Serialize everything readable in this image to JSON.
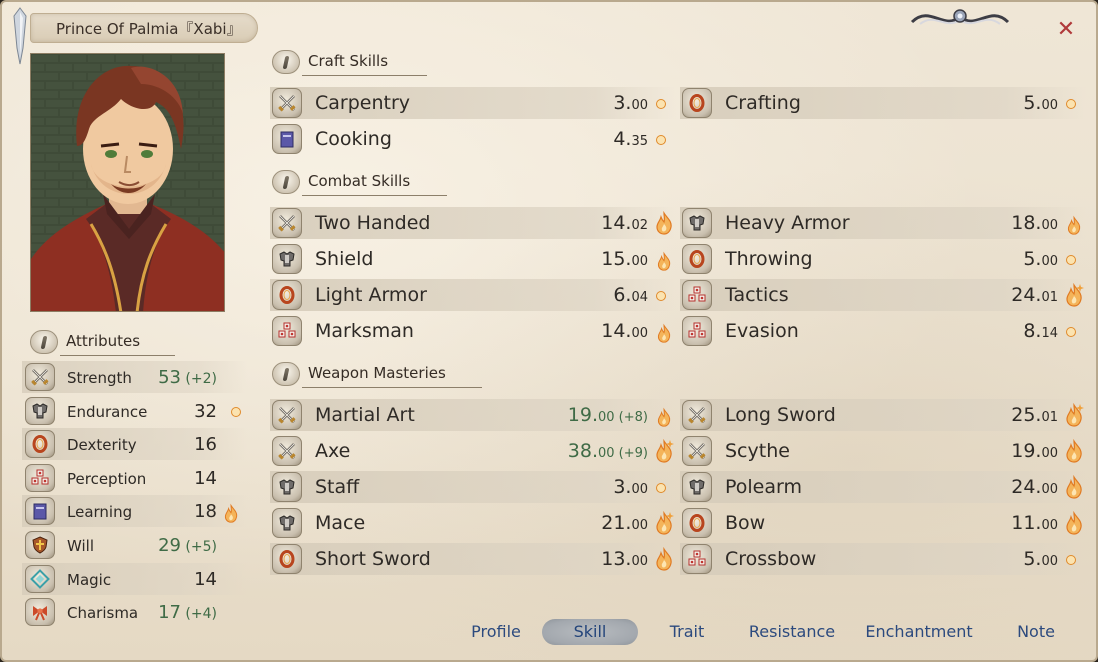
{
  "window": {
    "title": "Prince Of Palmia『Xabi』",
    "close_glyph": "✕"
  },
  "sections": {
    "craft": "Craft Skills",
    "combat": "Combat Skills",
    "weapon": "Weapon Masteries",
    "attributes": "Attributes"
  },
  "craft_skills": [
    {
      "name": "Carpentry",
      "int": "3.",
      "dec": "00",
      "icon": "crossed-swords-icon",
      "potential": "small"
    },
    {
      "name": "Crafting",
      "int": "5.",
      "dec": "00",
      "icon": "red-ring-icon",
      "potential": "small"
    },
    {
      "name": "Cooking",
      "int": "4.",
      "dec": "35",
      "icon": "book-icon",
      "potential": "small"
    }
  ],
  "combat_skills": [
    {
      "name": "Two Handed",
      "int": "14.",
      "dec": "02",
      "icon": "crossed-swords-icon",
      "potential": "flame"
    },
    {
      "name": "Heavy Armor",
      "int": "18.",
      "dec": "00",
      "icon": "armor-icon",
      "potential": "flame-small"
    },
    {
      "name": "Shield",
      "int": "15.",
      "dec": "00",
      "icon": "armor-icon",
      "potential": "flame-small"
    },
    {
      "name": "Throwing",
      "int": "5.",
      "dec": "00",
      "icon": "red-ring-icon",
      "potential": "small"
    },
    {
      "name": "Light Armor",
      "int": "6.",
      "dec": "04",
      "icon": "red-ring-icon",
      "potential": "small"
    },
    {
      "name": "Tactics",
      "int": "24.",
      "dec": "01",
      "icon": "dice-icon",
      "potential": "flame-sparkle"
    },
    {
      "name": "Marksman",
      "int": "14.",
      "dec": "00",
      "icon": "dice-icon",
      "potential": "flame-small"
    },
    {
      "name": "Evasion",
      "int": "8.",
      "dec": "14",
      "icon": "dice-icon",
      "potential": "small"
    }
  ],
  "weapon_masteries": [
    {
      "name": "Martial Art",
      "int": "19.",
      "dec": "00",
      "bonus": " (+8)",
      "icon": "crossed-swords-icon",
      "potential": "flame-small"
    },
    {
      "name": "Long Sword",
      "int": "25.",
      "dec": "01",
      "bonus": "",
      "icon": "crossed-swords-icon",
      "potential": "flame-sparkle"
    },
    {
      "name": "Axe",
      "int": "38.",
      "dec": "00",
      "bonus": " (+9)",
      "icon": "crossed-swords-icon",
      "potential": "flame-sparkle"
    },
    {
      "name": "Scythe",
      "int": "19.",
      "dec": "00",
      "bonus": "",
      "icon": "crossed-swords-icon",
      "potential": "flame"
    },
    {
      "name": "Staff",
      "int": "3.",
      "dec": "00",
      "bonus": "",
      "icon": "armor-icon",
      "potential": "small"
    },
    {
      "name": "Polearm",
      "int": "24.",
      "dec": "00",
      "bonus": "",
      "icon": "armor-icon",
      "potential": "flame"
    },
    {
      "name": "Mace",
      "int": "21.",
      "dec": "00",
      "bonus": "",
      "icon": "armor-icon",
      "potential": "flame-sparkle"
    },
    {
      "name": "Bow",
      "int": "11.",
      "dec": "00",
      "bonus": "",
      "icon": "red-ring-icon",
      "potential": "flame"
    },
    {
      "name": "Short Sword",
      "int": "13.",
      "dec": "00",
      "bonus": "",
      "icon": "red-ring-icon",
      "potential": "flame"
    },
    {
      "name": "Crossbow",
      "int": "5.",
      "dec": "00",
      "bonus": "",
      "icon": "dice-icon",
      "potential": "small"
    }
  ],
  "attributes": [
    {
      "name": "Strength",
      "value": "53",
      "bonus": " (+2)",
      "icon": "crossed-swords-icon",
      "potential": ""
    },
    {
      "name": "Endurance",
      "value": "32",
      "bonus": "",
      "icon": "armor-icon",
      "potential": "small"
    },
    {
      "name": "Dexterity",
      "value": "16",
      "bonus": "",
      "icon": "red-ring-icon",
      "potential": ""
    },
    {
      "name": "Perception",
      "value": "14",
      "bonus": "",
      "icon": "dice-icon",
      "potential": ""
    },
    {
      "name": "Learning",
      "value": "18",
      "bonus": "",
      "icon": "book-icon",
      "potential": "flame-small"
    },
    {
      "name": "Will",
      "value": "29",
      "bonus": " (+5)",
      "icon": "shield-icon",
      "potential": ""
    },
    {
      "name": "Magic",
      "value": "14",
      "bonus": "",
      "icon": "rune-icon",
      "potential": ""
    },
    {
      "name": "Charisma",
      "value": "17",
      "bonus": " (+4)",
      "icon": "ribbon-icon",
      "potential": ""
    }
  ],
  "tabs": [
    {
      "label": "Profile",
      "active": false
    },
    {
      "label": "Skill",
      "active": true
    },
    {
      "label": "Trait",
      "active": false
    },
    {
      "label": "Resistance",
      "active": false
    },
    {
      "label": "Enchantment",
      "active": false
    },
    {
      "label": "Note",
      "active": false
    }
  ],
  "colors": {
    "bonus_green": "#3f6b46",
    "tab_blue": "#2c4a7e",
    "close_red": "#b0393a",
    "potential_orange": "#e08a2a"
  }
}
